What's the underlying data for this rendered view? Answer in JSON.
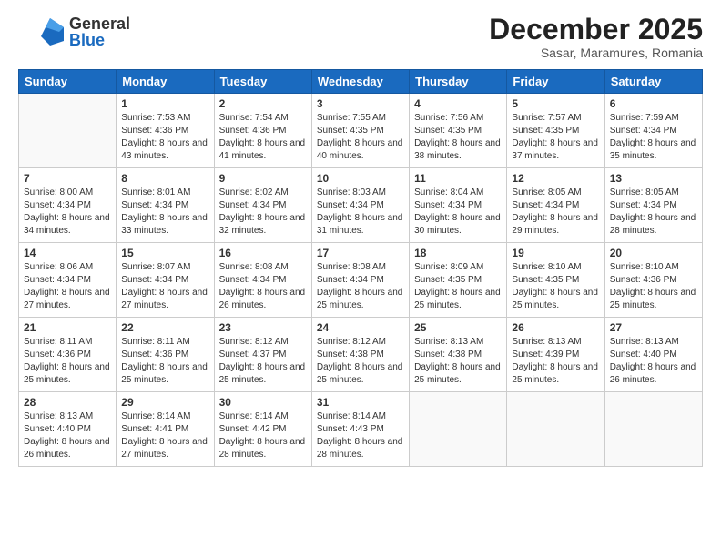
{
  "header": {
    "logo": {
      "general": "General",
      "blue": "Blue"
    },
    "title": "December 2025",
    "location": "Sasar, Maramures, Romania"
  },
  "calendar": {
    "days_of_week": [
      "Sunday",
      "Monday",
      "Tuesday",
      "Wednesday",
      "Thursday",
      "Friday",
      "Saturday"
    ],
    "weeks": [
      [
        {
          "day": "",
          "sunrise": "",
          "sunset": "",
          "daylight": ""
        },
        {
          "day": "1",
          "sunrise": "Sunrise: 7:53 AM",
          "sunset": "Sunset: 4:36 PM",
          "daylight": "Daylight: 8 hours and 43 minutes."
        },
        {
          "day": "2",
          "sunrise": "Sunrise: 7:54 AM",
          "sunset": "Sunset: 4:36 PM",
          "daylight": "Daylight: 8 hours and 41 minutes."
        },
        {
          "day": "3",
          "sunrise": "Sunrise: 7:55 AM",
          "sunset": "Sunset: 4:35 PM",
          "daylight": "Daylight: 8 hours and 40 minutes."
        },
        {
          "day": "4",
          "sunrise": "Sunrise: 7:56 AM",
          "sunset": "Sunset: 4:35 PM",
          "daylight": "Daylight: 8 hours and 38 minutes."
        },
        {
          "day": "5",
          "sunrise": "Sunrise: 7:57 AM",
          "sunset": "Sunset: 4:35 PM",
          "daylight": "Daylight: 8 hours and 37 minutes."
        },
        {
          "day": "6",
          "sunrise": "Sunrise: 7:59 AM",
          "sunset": "Sunset: 4:34 PM",
          "daylight": "Daylight: 8 hours and 35 minutes."
        }
      ],
      [
        {
          "day": "7",
          "sunrise": "Sunrise: 8:00 AM",
          "sunset": "Sunset: 4:34 PM",
          "daylight": "Daylight: 8 hours and 34 minutes."
        },
        {
          "day": "8",
          "sunrise": "Sunrise: 8:01 AM",
          "sunset": "Sunset: 4:34 PM",
          "daylight": "Daylight: 8 hours and 33 minutes."
        },
        {
          "day": "9",
          "sunrise": "Sunrise: 8:02 AM",
          "sunset": "Sunset: 4:34 PM",
          "daylight": "Daylight: 8 hours and 32 minutes."
        },
        {
          "day": "10",
          "sunrise": "Sunrise: 8:03 AM",
          "sunset": "Sunset: 4:34 PM",
          "daylight": "Daylight: 8 hours and 31 minutes."
        },
        {
          "day": "11",
          "sunrise": "Sunrise: 8:04 AM",
          "sunset": "Sunset: 4:34 PM",
          "daylight": "Daylight: 8 hours and 30 minutes."
        },
        {
          "day": "12",
          "sunrise": "Sunrise: 8:05 AM",
          "sunset": "Sunset: 4:34 PM",
          "daylight": "Daylight: 8 hours and 29 minutes."
        },
        {
          "day": "13",
          "sunrise": "Sunrise: 8:05 AM",
          "sunset": "Sunset: 4:34 PM",
          "daylight": "Daylight: 8 hours and 28 minutes."
        }
      ],
      [
        {
          "day": "14",
          "sunrise": "Sunrise: 8:06 AM",
          "sunset": "Sunset: 4:34 PM",
          "daylight": "Daylight: 8 hours and 27 minutes."
        },
        {
          "day": "15",
          "sunrise": "Sunrise: 8:07 AM",
          "sunset": "Sunset: 4:34 PM",
          "daylight": "Daylight: 8 hours and 27 minutes."
        },
        {
          "day": "16",
          "sunrise": "Sunrise: 8:08 AM",
          "sunset": "Sunset: 4:34 PM",
          "daylight": "Daylight: 8 hours and 26 minutes."
        },
        {
          "day": "17",
          "sunrise": "Sunrise: 8:08 AM",
          "sunset": "Sunset: 4:34 PM",
          "daylight": "Daylight: 8 hours and 25 minutes."
        },
        {
          "day": "18",
          "sunrise": "Sunrise: 8:09 AM",
          "sunset": "Sunset: 4:35 PM",
          "daylight": "Daylight: 8 hours and 25 minutes."
        },
        {
          "day": "19",
          "sunrise": "Sunrise: 8:10 AM",
          "sunset": "Sunset: 4:35 PM",
          "daylight": "Daylight: 8 hours and 25 minutes."
        },
        {
          "day": "20",
          "sunrise": "Sunrise: 8:10 AM",
          "sunset": "Sunset: 4:36 PM",
          "daylight": "Daylight: 8 hours and 25 minutes."
        }
      ],
      [
        {
          "day": "21",
          "sunrise": "Sunrise: 8:11 AM",
          "sunset": "Sunset: 4:36 PM",
          "daylight": "Daylight: 8 hours and 25 minutes."
        },
        {
          "day": "22",
          "sunrise": "Sunrise: 8:11 AM",
          "sunset": "Sunset: 4:36 PM",
          "daylight": "Daylight: 8 hours and 25 minutes."
        },
        {
          "day": "23",
          "sunrise": "Sunrise: 8:12 AM",
          "sunset": "Sunset: 4:37 PM",
          "daylight": "Daylight: 8 hours and 25 minutes."
        },
        {
          "day": "24",
          "sunrise": "Sunrise: 8:12 AM",
          "sunset": "Sunset: 4:38 PM",
          "daylight": "Daylight: 8 hours and 25 minutes."
        },
        {
          "day": "25",
          "sunrise": "Sunrise: 8:13 AM",
          "sunset": "Sunset: 4:38 PM",
          "daylight": "Daylight: 8 hours and 25 minutes."
        },
        {
          "day": "26",
          "sunrise": "Sunrise: 8:13 AM",
          "sunset": "Sunset: 4:39 PM",
          "daylight": "Daylight: 8 hours and 25 minutes."
        },
        {
          "day": "27",
          "sunrise": "Sunrise: 8:13 AM",
          "sunset": "Sunset: 4:40 PM",
          "daylight": "Daylight: 8 hours and 26 minutes."
        }
      ],
      [
        {
          "day": "28",
          "sunrise": "Sunrise: 8:13 AM",
          "sunset": "Sunset: 4:40 PM",
          "daylight": "Daylight: 8 hours and 26 minutes."
        },
        {
          "day": "29",
          "sunrise": "Sunrise: 8:14 AM",
          "sunset": "Sunset: 4:41 PM",
          "daylight": "Daylight: 8 hours and 27 minutes."
        },
        {
          "day": "30",
          "sunrise": "Sunrise: 8:14 AM",
          "sunset": "Sunset: 4:42 PM",
          "daylight": "Daylight: 8 hours and 28 minutes."
        },
        {
          "day": "31",
          "sunrise": "Sunrise: 8:14 AM",
          "sunset": "Sunset: 4:43 PM",
          "daylight": "Daylight: 8 hours and 28 minutes."
        },
        {
          "day": "",
          "sunrise": "",
          "sunset": "",
          "daylight": ""
        },
        {
          "day": "",
          "sunrise": "",
          "sunset": "",
          "daylight": ""
        },
        {
          "day": "",
          "sunrise": "",
          "sunset": "",
          "daylight": ""
        }
      ]
    ]
  }
}
